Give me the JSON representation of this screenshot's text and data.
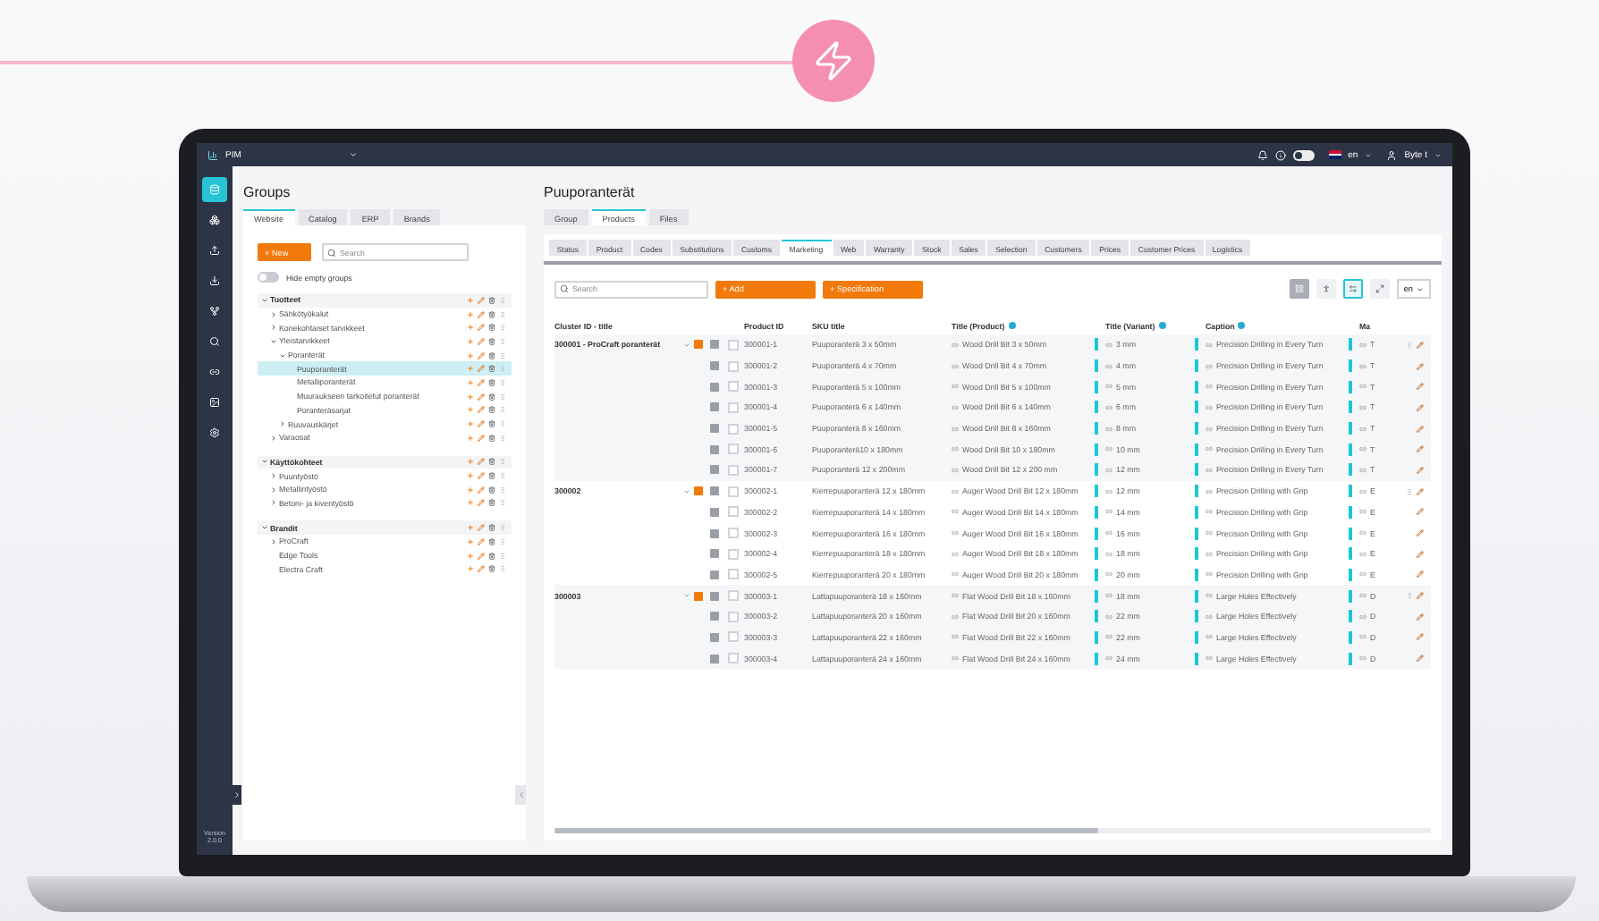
{
  "app": {
    "name": "PIM",
    "language": "en",
    "user": "Byte t",
    "dark_mode": false,
    "version": "Version 2.0.0"
  },
  "sidebar": {
    "items": [
      {
        "selected": true
      },
      {
        "selected": false
      },
      {
        "selected": false
      },
      {
        "selected": false
      },
      {
        "selected": false
      },
      {
        "selected": false
      },
      {
        "selected": false
      },
      {
        "selected": false
      },
      {
        "selected": false
      }
    ]
  },
  "groups": {
    "title": "Groups",
    "tabs": [
      {
        "label": "Website",
        "selected": true
      },
      {
        "label": "Catalog",
        "selected": false
      },
      {
        "label": "ERP",
        "selected": false
      },
      {
        "label": "Brands",
        "selected": false
      }
    ],
    "new_button": "+ New",
    "search": {
      "placeholder": "Search"
    },
    "hide_empty": {
      "label": "Hide empty groups",
      "on": false
    },
    "tree": [
      {
        "label": "Tuotteet",
        "expandable": true,
        "expanded": true,
        "selected": false,
        "children": [
          {
            "label": "Sähkötyökalut",
            "expandable": true,
            "expanded": false,
            "selected": false
          },
          {
            "label": "Konekohtaiset tarvikkeet",
            "expandable": true,
            "expanded": false,
            "selected": false
          },
          {
            "label": "Yleistarvikkeet",
            "expandable": true,
            "expanded": true,
            "selected": false,
            "children": [
              {
                "label": "Poranterät",
                "expandable": true,
                "expanded": true,
                "selected": false,
                "children": [
                  {
                    "label": "Puuporanterät",
                    "expandable": false,
                    "expanded": false,
                    "selected": true
                  },
                  {
                    "label": "Metalliporanterät",
                    "expandable": false,
                    "expanded": false,
                    "selected": false
                  },
                  {
                    "label": "Muuraukseen tarkoitetut poranterät",
                    "expandable": false,
                    "expanded": false,
                    "selected": false
                  },
                  {
                    "label": "Poranteräsarjat",
                    "expandable": false,
                    "expanded": false,
                    "selected": false
                  }
                ]
              },
              {
                "label": "Ruuvauskärjet",
                "expandable": true,
                "expanded": false,
                "selected": false
              }
            ]
          },
          {
            "label": "Varaosat",
            "expandable": true,
            "expanded": false,
            "selected": false
          }
        ]
      },
      {
        "label": "Käyttökohteet",
        "expandable": true,
        "expanded": true,
        "selected": false,
        "children": [
          {
            "label": "Puuntyöstö",
            "expandable": true,
            "expanded": false,
            "selected": false
          },
          {
            "label": "Metallintyöstö",
            "expandable": true,
            "expanded": false,
            "selected": false
          },
          {
            "label": "Betoni- ja kiventyöstö",
            "expandable": true,
            "expanded": false,
            "selected": false
          }
        ]
      },
      {
        "label": "Brandit",
        "expandable": true,
        "expanded": true,
        "selected": false,
        "children": [
          {
            "label": "ProCraft",
            "expandable": true,
            "expanded": false,
            "selected": false
          },
          {
            "label": "Edge Tools",
            "expandable": false,
            "expanded": false,
            "selected": false
          },
          {
            "label": "Electra Craft",
            "expandable": false,
            "expanded": false,
            "selected": false
          }
        ]
      }
    ]
  },
  "main": {
    "title": "Puuporanterät",
    "tabs": [
      {
        "label": "Group",
        "selected": false
      },
      {
        "label": "Products",
        "selected": true
      },
      {
        "label": "Files",
        "selected": false
      }
    ],
    "subtabs": [
      {
        "label": "Status",
        "selected": false
      },
      {
        "label": "Product",
        "selected": false
      },
      {
        "label": "Codes",
        "selected": false
      },
      {
        "label": "Substitutions",
        "selected": false
      },
      {
        "label": "Customs",
        "selected": false
      },
      {
        "label": "Marketing",
        "selected": true
      },
      {
        "label": "Web",
        "selected": false
      },
      {
        "label": "Warranty",
        "selected": false
      },
      {
        "label": "Stock",
        "selected": false
      },
      {
        "label": "Sales",
        "selected": false
      },
      {
        "label": "Selection",
        "selected": false
      },
      {
        "label": "Customers",
        "selected": false
      },
      {
        "label": "Prices",
        "selected": false
      },
      {
        "label": "Customer Prices",
        "selected": false
      },
      {
        "label": "Logistics",
        "selected": false
      }
    ],
    "search": {
      "placeholder": "Search"
    },
    "add_button": "+ Add",
    "spec_button": "+ Specification",
    "view_buttons": [
      {
        "selected": true
      },
      {
        "selected": false
      },
      {
        "selected": true
      },
      {
        "selected": false
      }
    ],
    "language": "en",
    "table": {
      "columns": [
        {
          "label": "Cluster ID - title",
          "info": false
        },
        {
          "label": "Product ID",
          "info": false
        },
        {
          "label": "SKU title",
          "info": false
        },
        {
          "label": "Title (Product)",
          "info": true
        },
        {
          "label": "Title (Variant)",
          "info": true
        },
        {
          "label": "Caption",
          "info": true
        },
        {
          "label": "Ma",
          "info": false
        }
      ],
      "clusters": [
        {
          "title": "300001 - ProCraft poranterät",
          "expanded": true,
          "rows": [
            {
              "product_id": "300001-1",
              "sku": "Puuporanterä 3 x 50mm",
              "title_product": "Wood Drill Bit 3 x 50mm",
              "title_variant": "3 mm",
              "caption": "Precision Drilling in Every Turn",
              "ma": "T",
              "checked": false
            },
            {
              "product_id": "300001-2",
              "sku": "Puuporanterä 4 x 70mm",
              "title_product": "Wood Drill Bit 4 x 70mm",
              "title_variant": "4 mm",
              "caption": "Precision Drilling in Every Turn",
              "ma": "T",
              "checked": false
            },
            {
              "product_id": "300001-3",
              "sku": "Puuporanterä 5 x 100mm",
              "title_product": "Wood Drill Bit 5 x 100mm",
              "title_variant": "5 mm",
              "caption": "Precision Drilling in Every Turn",
              "ma": "T",
              "checked": false
            },
            {
              "product_id": "300001-4",
              "sku": "Puuporanterä 6 x 140mm",
              "title_product": "Wood Drill Bit 6 x 140mm",
              "title_variant": "6 mm",
              "caption": "Precision Drilling in Every Turn",
              "ma": "T",
              "checked": false
            },
            {
              "product_id": "300001-5",
              "sku": "Puuporanterä 8 x 160mm",
              "title_product": "Wood Drill Bit 8 x 160mm",
              "title_variant": "8 mm",
              "caption": "Precision Drilling in Every Turn",
              "ma": "T",
              "checked": false
            },
            {
              "product_id": "300001-6",
              "sku": "Puuporanterä10 x 180mm",
              "title_product": "Wood Drill Bit 10 x 180mm",
              "title_variant": "10 mm",
              "caption": "Precision Drilling in Every Turn",
              "ma": "T",
              "checked": false
            },
            {
              "product_id": "300001-7",
              "sku": "Puuporanterä 12 x 200mm",
              "title_product": "Wood Drill Bit 12 x 200 mm",
              "title_variant": "12 mm",
              "caption": "Precision Drilling in Every Turn",
              "ma": "T",
              "checked": false
            }
          ]
        },
        {
          "title": "300002",
          "expanded": true,
          "rows": [
            {
              "product_id": "300002-1",
              "sku": "Kierrepuuporanterä 12 x 180mm",
              "title_product": "Auger Wood Drill Bit 12 x 180mm",
              "title_variant": "12 mm",
              "caption": "Precision Drilling with Grip",
              "ma": "E",
              "checked": false
            },
            {
              "product_id": "300002-2",
              "sku": "Kierrepuuporanterä 14 x 180mm",
              "title_product": "Auger Wood Drill Bit 14 x 180mm",
              "title_variant": "14 mm",
              "caption": "Precision Drilling with Grip",
              "ma": "E",
              "checked": false
            },
            {
              "product_id": "300002-3",
              "sku": "Kierrepuuporanterä 16 x 180mm",
              "title_product": "Auger Wood Drill Bit 16 x 180mm",
              "title_variant": "16 mm",
              "caption": "Precision Drilling with Grip",
              "ma": "E",
              "checked": false
            },
            {
              "product_id": "300002-4",
              "sku": "Kierrepuuporanterä 18 x 180mm",
              "title_product": "Auger Wood Drill Bit 18 x 180mm",
              "title_variant": "18 mm",
              "caption": "Precision Drilling with Grip",
              "ma": "E",
              "checked": false
            },
            {
              "product_id": "300002-5",
              "sku": "Kierrepuuporanterä 20 x 180mm",
              "title_product": "Auger Wood Drill Bit 20 x 180mm",
              "title_variant": "20 mm",
              "caption": "Precision Drilling with Grip",
              "ma": "E",
              "checked": false
            }
          ]
        },
        {
          "title": "300003",
          "expanded": true,
          "rows": [
            {
              "product_id": "300003-1",
              "sku": "Lattapuuporanterä 18 x 160mm",
              "title_product": "Flat Wood Drill Bit 18 x 160mm",
              "title_variant": "18 mm",
              "caption": "Large Holes Effectively",
              "ma": "D",
              "checked": false
            },
            {
              "product_id": "300003-2",
              "sku": "Lattapuuporanterä 20 x 160mm",
              "title_product": "Flat Wood Drill Bit 20 x 160mm",
              "title_variant": "22 mm",
              "caption": "Large Holes Effectively",
              "ma": "D",
              "checked": false
            },
            {
              "product_id": "300003-3",
              "sku": "Lattapuuporanterä 22 x 160mm",
              "title_product": "Flat Wood Drill Bit 22 x 160mm",
              "title_variant": "22 mm",
              "caption": "Large Holes Effectively",
              "ma": "D",
              "checked": false
            },
            {
              "product_id": "300003-4",
              "sku": "Lattapuuporanterä 24 x 160mm",
              "title_product": "Flat Wood Drill Bit 24 x 160mm",
              "title_variant": "24 mm",
              "caption": "Large Holes Effectively",
              "ma": "D",
              "checked": false
            }
          ]
        }
      ]
    }
  }
}
